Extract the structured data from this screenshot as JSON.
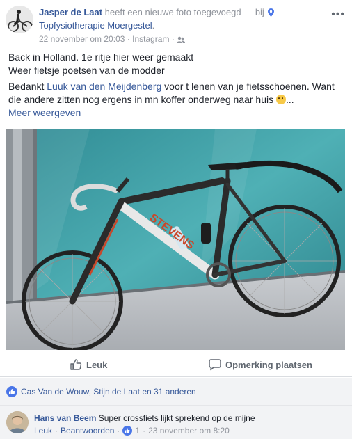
{
  "post": {
    "author": "Jasper de Laat",
    "action_text": "heeft een nieuwe foto toegevoegd",
    "dash": "—",
    "at_text": "bij",
    "place": "Topfysiotherapie Moergestel",
    "place_suffix": ".",
    "timestamp": "22 november om 20:03",
    "separator": "·",
    "source": "Instagram",
    "more_label": "•••",
    "audience_icon": "friends-icon",
    "location_icon": "map-pin-icon"
  },
  "text": {
    "line1": "Back in Holland. 1e ritje hier weer gemaakt",
    "line2": "Weer fietsje poetsen van de modder",
    "p2_start": "Bedankt ",
    "mention": "Luuk van den Meijdenberg",
    "p2_end": " voor t lenen van je fietsschoenen. Want die andere zitten nog ergens in mn koffer onderweg naar huis ",
    "ellipsis": "...",
    "see_more": "Meer weergeven"
  },
  "actions": {
    "like_label": "Leuk",
    "comment_label": "Opmerking plaatsen"
  },
  "reactions": {
    "summary": "Cas Van de Wouw, Stijn de Laat en 31 anderen"
  },
  "comment": {
    "author": "Hans van Beem",
    "text": "Super crossfiets lijkt sprekend op de mijne",
    "like_label": "Leuk",
    "reply_label": "Beantwoorden",
    "dot": "·",
    "like_count": "1",
    "timestamp": "23 november om 8:20"
  },
  "colors": {
    "link": "#365899",
    "muted": "#90949c",
    "like_blue": "#4a76e8",
    "bg_secondary": "#f2f3f5"
  }
}
